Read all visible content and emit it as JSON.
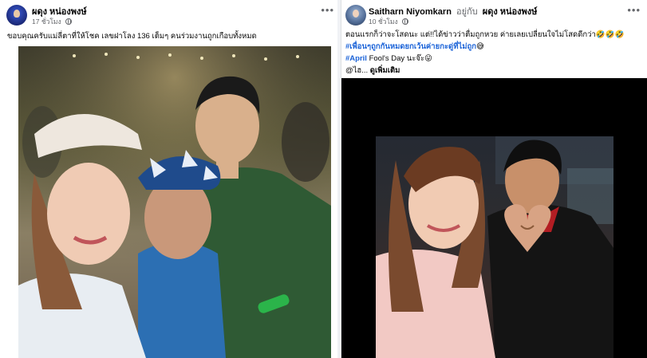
{
  "posts": [
    {
      "author": "ผดุง หน่องพงษ์",
      "time": "17 ชั่วโมง",
      "caption": "ขอบคุณครับแม่ลี่ตาที่ให้โชค เลขฝาโลง 136 เต็มๆ คนร่วมงานถูกเกือบทั้งหมด",
      "more_icon": "more-icon",
      "privacy_icon": "globe-icon"
    },
    {
      "author": "Saitharn Niyomkarn",
      "in_word": "อยู่กับ",
      "with_name": "ผดุง หน่องพงษ์",
      "time": "10 ชั่วโมง",
      "line1": "ตอนแรกก็ว่าจะโสดนะ แต่!!ได้ข่าวว่าตื่มถูกหวย ค่ายเลยเปลี่ยนใจไม่โสดดีกว่า🤣🤣🤣",
      "hashtag1": "#เพื่อนๆถูกกันหมดยกเว้นค่ายกะดู่ที่ไม่ถูก",
      "line2_suffix": "😅",
      "hashtag2": "#April",
      "line3_suffix": " Fool's Day นะจ๊ะ😜",
      "line4": "@ไฮ... ",
      "see_more": "ดูเพิ่มเติม",
      "more_icon": "more-icon",
      "privacy_icon": "globe-icon"
    }
  ],
  "colors": {
    "page_bg": "#f0f2f5",
    "card_bg": "#ffffff",
    "link_blue": "#1b63d8",
    "secondary_text": "#65676b"
  }
}
